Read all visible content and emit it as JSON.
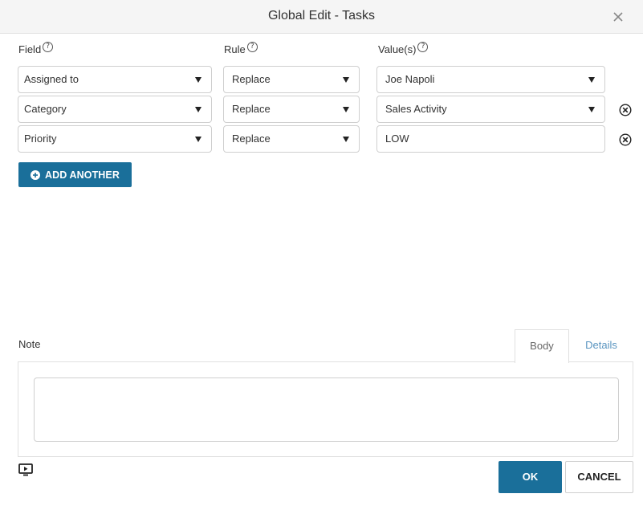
{
  "dialog": {
    "title": "Global Edit - Tasks",
    "close_icon": "close-icon"
  },
  "columns": {
    "field": "Field",
    "rule": "Rule",
    "values": "Value(s)",
    "help_glyph": "?"
  },
  "rows": [
    {
      "field": "Assigned to",
      "rule": "Replace",
      "value": "Joe Napoli",
      "value_type": "select",
      "removable": false
    },
    {
      "field": "Category",
      "rule": "Replace",
      "value": "Sales Activity",
      "value_type": "select",
      "removable": true
    },
    {
      "field": "Priority",
      "rule": "Replace",
      "value": "LOW",
      "value_type": "text",
      "removable": true
    }
  ],
  "add_another_label": "ADD ANOTHER",
  "note": {
    "label": "Note",
    "tabs": [
      {
        "label": "Body",
        "active": true
      },
      {
        "label": "Details",
        "active": false
      }
    ],
    "body_value": ""
  },
  "footer": {
    "ok_label": "OK",
    "cancel_label": "CANCEL",
    "video_icon": "video-icon"
  },
  "colors": {
    "primary": "#1a6f9a",
    "header_bg": "#f5f5f5",
    "tab_link": "#5a95c0"
  }
}
